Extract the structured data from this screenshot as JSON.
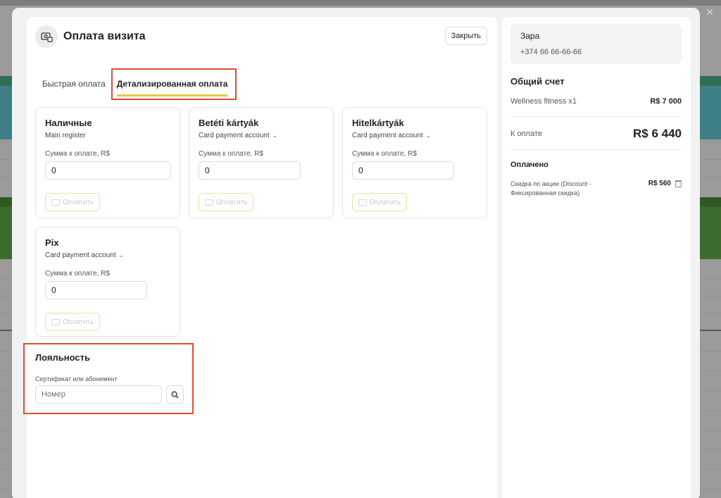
{
  "dialog": {
    "title": "Оплата визита",
    "close_label": "Закрыть"
  },
  "tabs": [
    {
      "label": "Быстрая оплата",
      "active": false
    },
    {
      "label": "Детализированная оплата",
      "active": true
    }
  ],
  "payment_methods": [
    {
      "name": "Наличные",
      "account": "Main register",
      "has_dropdown": false,
      "amount_label": "Сумма к оплате, R$",
      "amount": "0",
      "pay_label": "Оплатить",
      "icon": "wallet-icon"
    },
    {
      "name": "Betéti kártyák",
      "account": "Card payment account",
      "has_dropdown": true,
      "amount_label": "Сумма к оплате, R$",
      "amount": "0",
      "pay_label": "Оплатить",
      "icon": "card-icon"
    },
    {
      "name": "Hitelkártyák",
      "account": "Card payment account",
      "has_dropdown": true,
      "amount_label": "Сумма к оплате, R$",
      "amount": "0",
      "pay_label": "Оплатить",
      "icon": "card-icon"
    },
    {
      "name": "Pix",
      "account": "Card payment account",
      "has_dropdown": true,
      "amount_label": "Сумма к оплате, R$",
      "amount": "0",
      "pay_label": "Оплатить",
      "icon": "card-icon"
    }
  ],
  "loyalty": {
    "title": "Лояльность",
    "field_label": "Сертификат или абонемент",
    "placeholder": "Номер"
  },
  "client": {
    "name": "Зара",
    "phone": "+374 66 66-66-66"
  },
  "bill": {
    "title": "Общий счет",
    "items": [
      {
        "name": "Wellness fitness  x1",
        "amount": "R$ 7 000"
      }
    ],
    "due_label": "К оплате",
    "due_amount": "R$ 6 440",
    "paid_title": "Оплачено",
    "paid_items": [
      {
        "desc": "Скидка по акции (Discount - Фиксированная скидка)",
        "amount": "R$ 560"
      }
    ]
  },
  "colors": {
    "accent_underline": "#e6c84a",
    "highlight_box": "#e24b34"
  }
}
